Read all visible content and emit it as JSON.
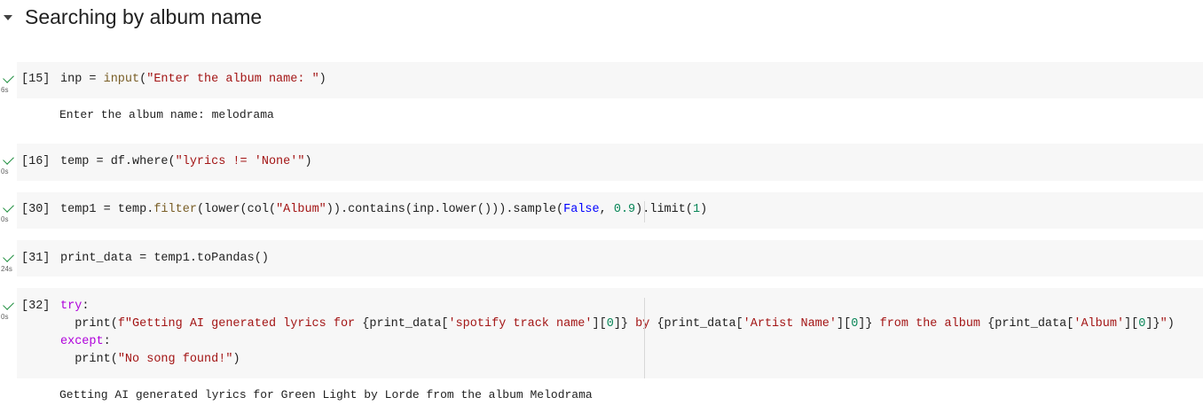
{
  "section": {
    "title": "Searching by album name"
  },
  "cells": [
    {
      "count": "[15]",
      "duration": "6s",
      "tokens": [
        [
          "inp = ",
          ""
        ],
        [
          "input",
          "fn"
        ],
        [
          "(",
          ""
        ],
        [
          "\"Enter the album name: \"",
          "str"
        ],
        [
          ")",
          ""
        ]
      ],
      "output": "Enter the album name: melodrama"
    },
    {
      "count": "[16]",
      "duration": "0s",
      "tokens": [
        [
          "temp = df.where(",
          ""
        ],
        [
          "\"lyrics != 'None'\"",
          "str"
        ],
        [
          ")",
          ""
        ]
      ]
    },
    {
      "count": "[30]",
      "duration": "0s",
      "tokens": [
        [
          "temp1 = temp.",
          ""
        ],
        [
          "filter",
          "fn"
        ],
        [
          "(lower(col(",
          ""
        ],
        [
          "\"Album\"",
          "str"
        ],
        [
          ")).contains(inp.lower())).sample(",
          ""
        ],
        [
          "False",
          "bool"
        ],
        [
          ", ",
          ""
        ],
        [
          "0.9",
          "num"
        ],
        [
          ").limit(",
          ""
        ],
        [
          "1",
          "num"
        ],
        [
          ")",
          ""
        ]
      ]
    },
    {
      "count": "[31]",
      "duration": "24s",
      "tokens": [
        [
          "print_data = temp1.toPandas()",
          ""
        ]
      ]
    },
    {
      "count": "[32]",
      "duration": "0s",
      "lines": [
        [
          [
            "try",
            "kw"
          ],
          [
            ":",
            ""
          ]
        ],
        [
          [
            "  print(",
            ""
          ],
          [
            "f\"Getting AI generated lyrics for ",
            "str"
          ],
          [
            "{print_data[",
            ""
          ],
          [
            "'spotify track name'",
            "str"
          ],
          [
            "][",
            ""
          ],
          [
            "0",
            "num"
          ],
          [
            "]}",
            ""
          ],
          [
            " by ",
            "str"
          ],
          [
            "{print_data[",
            ""
          ],
          [
            "'Artist Name'",
            "str"
          ],
          [
            "][",
            ""
          ],
          [
            "0",
            "num"
          ],
          [
            "]}",
            ""
          ],
          [
            " from the album ",
            "str"
          ],
          [
            "{print_data[",
            ""
          ],
          [
            "'Album'",
            "str"
          ],
          [
            "][",
            ""
          ],
          [
            "0",
            "num"
          ],
          [
            "]}",
            ""
          ],
          [
            "\"",
            "str"
          ],
          [
            ")",
            ""
          ]
        ],
        [
          [
            "except",
            "kw"
          ],
          [
            ":",
            ""
          ]
        ],
        [
          [
            "  print(",
            ""
          ],
          [
            "\"No song found!\"",
            "str"
          ],
          [
            ")",
            ""
          ]
        ]
      ],
      "output": "Getting AI generated lyrics for Green Light by Lorde from the album Melodrama"
    }
  ]
}
